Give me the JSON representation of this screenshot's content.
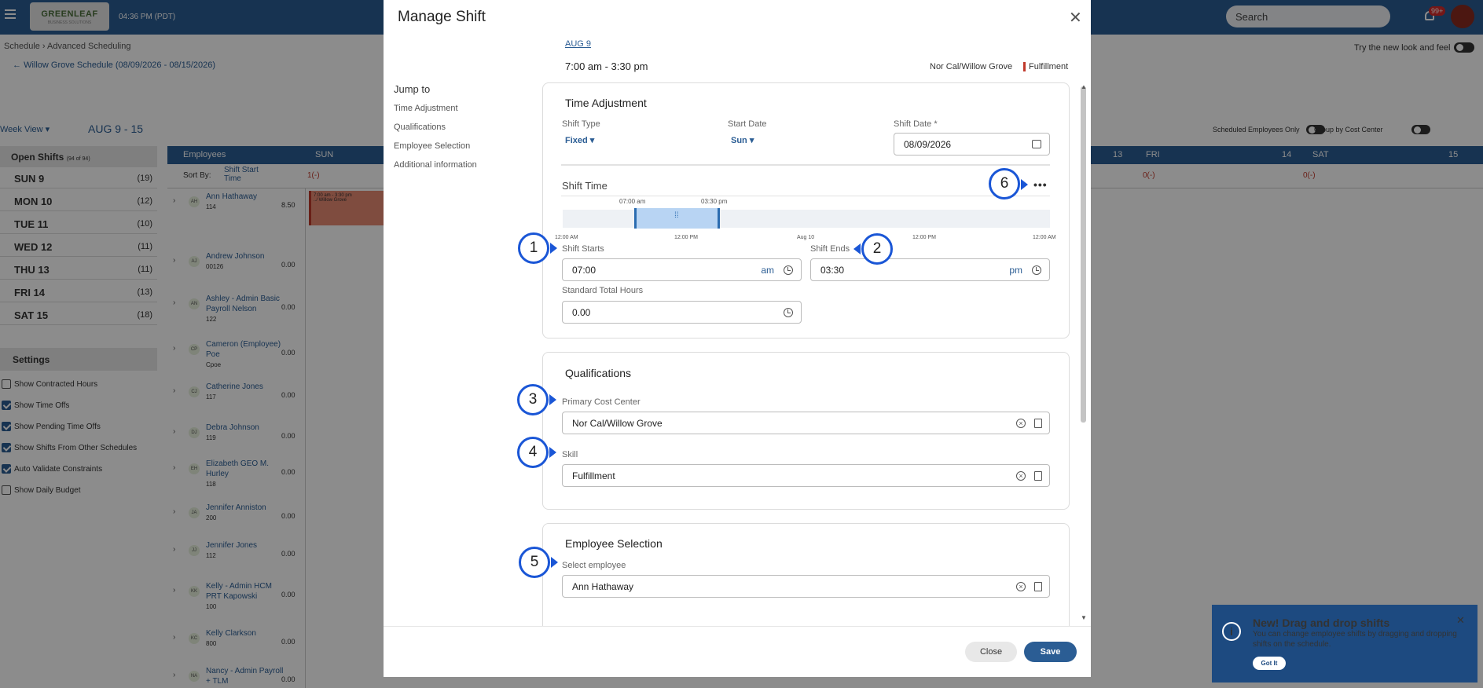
{
  "topbar": {
    "logo": "GREENLEAF",
    "logo_sub": "BUSINESS SOLUTIONS",
    "time": "04:36 PM (PDT)",
    "search_placeholder": "Search",
    "notif_count": "99+"
  },
  "background": {
    "breadcrumb": "Schedule  ›  Advanced Scheduling",
    "schedule_title": "Willow Grove Schedule (08/09/2026 - 08/15/2026)",
    "new_look": "Try the new look and feel",
    "week_view": "Week View",
    "week_range": "AUG 9 - 15",
    "scheduled_only": "Scheduled Employees Only",
    "group_by": "Group by Cost Center",
    "open_shifts": "Open Shifts",
    "open_shifts_count": "(94 of 94)",
    "days": [
      {
        "label": "SUN 9",
        "count": "(19)"
      },
      {
        "label": "MON 10",
        "count": "(12)"
      },
      {
        "label": "TUE 11",
        "count": "(10)"
      },
      {
        "label": "WED 12",
        "count": "(11)"
      },
      {
        "label": "THU 13",
        "count": "(11)"
      },
      {
        "label": "FRI 14",
        "count": "(13)"
      },
      {
        "label": "SAT 15",
        "count": "(18)"
      }
    ],
    "settings_title": "Settings",
    "settings": [
      {
        "label": "Show Contracted Hours",
        "checked": false
      },
      {
        "label": "Show Time Offs",
        "checked": true
      },
      {
        "label": "Show Pending Time Offs",
        "checked": true
      },
      {
        "label": "Show Shifts From Other Schedules",
        "checked": true
      },
      {
        "label": "Auto Validate Constraints",
        "checked": true
      },
      {
        "label": "Show Daily Budget",
        "checked": false
      }
    ],
    "employees_header": "Employees",
    "sort_by": "Sort By:",
    "sort_value": "Shift Start Time",
    "col_sun": "SUN",
    "col_13": "13",
    "col_fri": "FRI",
    "col_14": "14",
    "col_sat": "SAT",
    "col_15": "15",
    "sun_open": "1(-)",
    "fri_open": "0(-)",
    "sat_open": "0(-)",
    "shift_block_time": "7:00 am - 3:30 pm",
    "shift_block_loc": "../ Willow Grove",
    "employees": [
      {
        "initials": "AH",
        "name": "Ann Hathaway",
        "id": "114",
        "hours": "8.50"
      },
      {
        "initials": "AJ",
        "name": "Andrew Johnson",
        "id": "00126",
        "hours": "0.00"
      },
      {
        "initials": "AN",
        "name": "Ashley - Admin Basic Payroll Nelson",
        "id": "122",
        "hours": "0.00"
      },
      {
        "initials": "CP",
        "name": "Cameron (Employee) Poe",
        "id": "Cpoe",
        "hours": "0.00"
      },
      {
        "initials": "CJ",
        "name": "Catherine Jones",
        "id": "117",
        "hours": "0.00"
      },
      {
        "initials": "DJ",
        "name": "Debra Johnson",
        "id": "119",
        "hours": "0.00"
      },
      {
        "initials": "EH",
        "name": "Elizabeth GEO M. Hurley",
        "id": "118",
        "hours": "0.00"
      },
      {
        "initials": "JA",
        "name": "Jennifer Anniston",
        "id": "200",
        "hours": "0.00"
      },
      {
        "initials": "JJ",
        "name": "Jennifer Jones",
        "id": "112",
        "hours": "0.00"
      },
      {
        "initials": "KK",
        "name": "Kelly - Admin HCM PRT Kapowski",
        "id": "100",
        "hours": "0.00"
      },
      {
        "initials": "KC",
        "name": "Kelly Clarkson",
        "id": "800",
        "hours": "0.00"
      },
      {
        "initials": "NA",
        "name": "Nancy - Admin Payroll + TLM",
        "id": "",
        "hours": "0.00"
      }
    ]
  },
  "modal": {
    "title": "Manage Shift",
    "jump_to": "Jump to",
    "jump_links": [
      "Time Adjustment",
      "Qualifications",
      "Employee Selection",
      "Additional information"
    ],
    "date_link": "AUG 9",
    "time_range": "7:00 am - 3:30 pm",
    "location": "Nor Cal/Willow Grove",
    "cost_center": "Fulfillment",
    "time_adjustment": {
      "title": "Time Adjustment",
      "shift_type_label": "Shift Type",
      "shift_type": "Fixed",
      "start_date_label": "Start Date",
      "start_date": "Sun",
      "shift_date_label": "Shift Date *",
      "shift_date": "08/09/2026",
      "shift_time_label": "Shift Time",
      "tl_start": "07:00 am",
      "tl_end": "03:30 pm",
      "tl_ticks": [
        "12:00 AM",
        "12:00 PM",
        "Aug 10",
        "12:00 PM",
        "12:00 AM"
      ],
      "shift_starts_label": "Shift Starts",
      "shift_starts": "07:00",
      "shift_starts_ampm": "am",
      "shift_ends_label": "Shift Ends",
      "shift_ends": "03:30",
      "shift_ends_ampm": "pm",
      "std_hours_label": "Standard Total Hours",
      "std_hours": "0.00"
    },
    "qualifications": {
      "title": "Qualifications",
      "cost_center_label": "Primary Cost Center",
      "cost_center": "Nor Cal/Willow Grove",
      "skill_label": "Skill",
      "skill": "Fulfillment"
    },
    "employee_selection": {
      "title": "Employee Selection",
      "select_label": "Select employee",
      "selected": "Ann Hathaway"
    },
    "close_label": "Close",
    "save_label": "Save"
  },
  "markers": [
    "1",
    "2",
    "3",
    "4",
    "5",
    "6"
  ],
  "toast": {
    "title": "New! Drag and drop shifts",
    "body": "You can change employee shifts by dragging and dropping shifts on the schedule.",
    "button": "Got It"
  }
}
